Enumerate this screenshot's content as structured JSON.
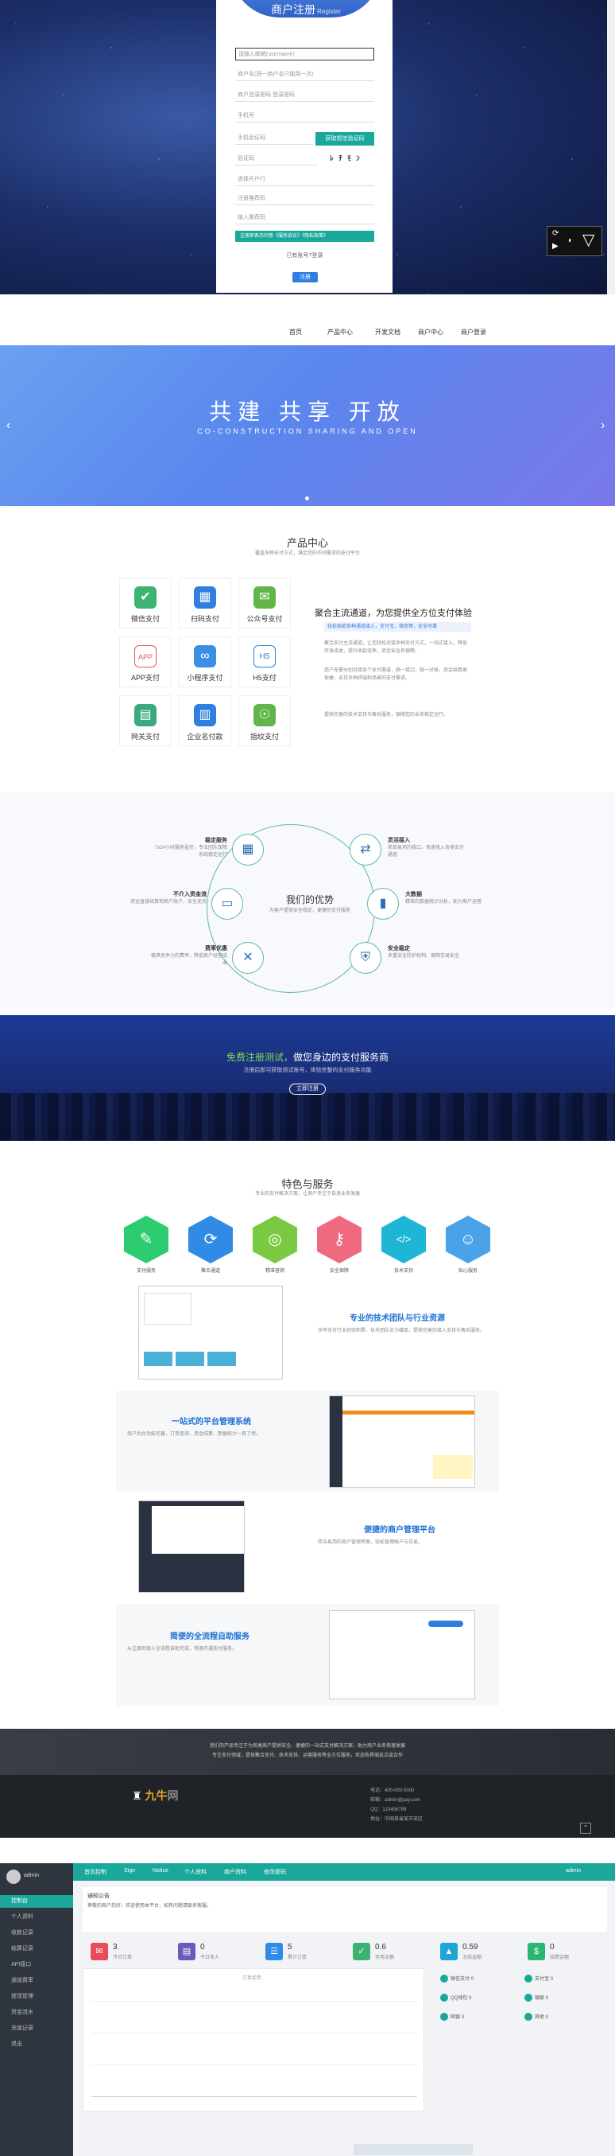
{
  "registration": {
    "title": "商户注册",
    "title_sub": "Register",
    "fields": [
      "请输入邮箱(username)",
      "商户名(同一商户名只能用一次)",
      "商户登录密码 登录密码",
      "手机号",
      "手机验证码",
      "验证码",
      "注册推荐码",
      "输入推荐码",
      "选择开户行"
    ],
    "sms_button": "获取短信验证码",
    "captcha_text": "ﾚ ﾁ ﾓ ﾝ",
    "agree_text": "注册即表示同意《服务协议》《隐私政策》",
    "to_login": "已有账号?登录",
    "submit": "注册",
    "video_controls": [
      "⟳",
      "▶",
      "◐",
      "▽"
    ]
  },
  "site": {
    "nav": [
      "首页",
      "产品中心",
      "开发文档",
      "商户中心",
      "商户登录"
    ],
    "hero": {
      "title": "共建  共享  开放",
      "subtitle": "CO-CONSTRUCTION  SHARING  AND  OPEN"
    },
    "products": {
      "title": "产品中心",
      "subtitle": "覆盖多种支付方式，满足您的不同需求的支付平台",
      "items": [
        {
          "label": "微信支付",
          "icon": "wechat-pay-icon",
          "color": "#3cb371",
          "glyph": "✔"
        },
        {
          "label": "扫码支付",
          "icon": "qrcode-pay-icon",
          "color": "#2f7fe0",
          "glyph": "▦"
        },
        {
          "label": "公众号支付",
          "icon": "official-account-icon",
          "color": "#62b54a",
          "glyph": "✉"
        },
        {
          "label": "APP支付",
          "icon": "app-pay-icon",
          "color": "#e35b5b",
          "glyph": "APP"
        },
        {
          "label": "小程序支付",
          "icon": "mini-program-icon",
          "color": "#3a8ee6",
          "glyph": "∞"
        },
        {
          "label": "H5支付",
          "icon": "h5-pay-icon",
          "color": "#2f7fe0",
          "glyph": "H5"
        },
        {
          "label": "网关支付",
          "icon": "gateway-pay-icon",
          "color": "#3aa97e",
          "glyph": "▤"
        },
        {
          "label": "企业名付款",
          "icon": "enterprise-pay-icon",
          "color": "#2f7fe0",
          "glyph": "▥"
        },
        {
          "label": "指纹支付",
          "icon": "fingerprint-pay-icon",
          "color": "#62b54a",
          "glyph": "☉"
        }
      ],
      "desc_title": "聚合主流通道，为您提供全方位支付体验",
      "desc_tag": "轻松收款各种通道接入，支付宝，微信等，安全可靠",
      "desc_paras": [
        "聚合支付主流通道，让您轻松对接多种支付方式，一站式接入，降低开发成本，提升收款效率，资金安全有保障。",
        "商户无需分别对接各个支付渠道，统一接口，统一对账，资金结算更快捷，支持多种终端和场景的支付需求。",
        "提供完善的技术支持与售后服务，保障您的业务稳定运行。"
      ]
    },
    "advantages": {
      "title": "我们的优势",
      "subtitle": "为客户提供安全稳定，便捷的支付服务",
      "items": [
        {
          "title": "稳定服务",
          "text": "7x24小时服务监控，专业团队保障系统稳定运行",
          "icon": "monitor-icon"
        },
        {
          "title": "灵活接入",
          "text": "简单易用的接口，快速接入各类支付通道",
          "icon": "plug-icon"
        },
        {
          "title": "不介入资金流",
          "text": "资金直接结算到商户账户，安全无忧",
          "icon": "wallet-icon"
        },
        {
          "title": "大数据",
          "text": "精准的数据统计分析，助力商户运营",
          "icon": "chart-icon"
        },
        {
          "title": "费率优惠",
          "text": "极具竞争力的费率，降低商户经营成本",
          "icon": "discount-icon"
        },
        {
          "title": "安全稳定",
          "text": "多重安全防护机制，保障交易安全",
          "icon": "shield-icon"
        }
      ]
    },
    "cta": {
      "title_green": "免费注册测试，",
      "title_white": "做您身边的支付服务商",
      "subtitle": "注册后即可获取测试账号，体验完整的支付服务功能",
      "button": "立即注册"
    },
    "features": {
      "title": "特色与服务",
      "subtitle": "专业的支付解决方案，让商户专注于自身业务发展",
      "hexes": [
        {
          "label": "支付服务",
          "color": "#2ecc71",
          "icon": "tag-icon",
          "glyph": "✎"
        },
        {
          "label": "聚合通道",
          "color": "#2f8be6",
          "icon": "network-icon",
          "glyph": "⟳"
        },
        {
          "label": "精准营销",
          "color": "#7ac943",
          "icon": "target-icon",
          "glyph": "◎"
        },
        {
          "label": "安全保障",
          "color": "#ef6a80",
          "icon": "lock-icon",
          "glyph": "⚷"
        },
        {
          "label": "技术支持",
          "color": "#1fb5d6",
          "icon": "code-icon",
          "glyph": "</>"
        },
        {
          "label": "贴心服务",
          "color": "#4aa3e8",
          "icon": "users-icon",
          "glyph": "☺"
        }
      ],
      "blocks": [
        {
          "title": "专业的技术团队与行业资源",
          "text": "多年支付行业经验积累，技术团队实力雄厚，提供完善的接入支持与售后服务。"
        },
        {
          "title": "一站式的平台管理系统",
          "text": "商户后台功能完善，订单查询、资金结算、数据统计一目了然。"
        },
        {
          "title": "便捷的商户管理平台",
          "text": "简洁易用的商户管理界面，轻松管理账户与交易。"
        },
        {
          "title": "简便的全流程自助服务",
          "text": "从注册到接入全流程自助完成，快速开通支付服务。"
        }
      ]
    },
    "footer": {
      "lines": [
        "我们的产品专注于为各类商户提供安全、便捷的一站式支付解决方案，助力商户业务快速发展",
        "专注支付领域，提供聚合支付、技术支持、运营服务等全方位服务，欢迎各界朋友洽谈合作"
      ],
      "logo": "九牛",
      "logo_suffix": "网",
      "contacts": [
        "电话：400-000-0000",
        "邮箱：admin@pay.com",
        "QQ：123456789",
        "地址：中国某省某市某区"
      ]
    }
  },
  "admin": {
    "top_tabs": [
      "首页控制",
      "Sign",
      "Notice",
      "个人资料",
      "商户资料",
      "修改密码"
    ],
    "user": "admin",
    "sidebar": [
      "控制台",
      "个人资料",
      "收款记录",
      "结算记录",
      "API接口",
      "通道费率",
      "提现管理",
      "资金流水",
      "充值记录",
      "退出"
    ],
    "notice_title": "通知公告",
    "notice_text": "尊敬的商户您好，欢迎使用本平台，如有问题请联系客服。",
    "stats": [
      {
        "label": "今日订单",
        "value": "3",
        "color": "#e84b5a",
        "glyph": "✉"
      },
      {
        "label": "今日收入",
        "value": "0",
        "color": "#6b5bb8",
        "glyph": "▤"
      },
      {
        "label": "累计订单",
        "value": "5",
        "color": "#2f8be6",
        "glyph": "☰"
      },
      {
        "label": "可用余额",
        "value": "0.6",
        "color": "#3cb371",
        "glyph": "✓"
      },
      {
        "label": "冻结金额",
        "value": "0.59",
        "color": "#1fa5d8",
        "glyph": "▲"
      },
      {
        "label": "结算金额",
        "value": "0",
        "color": "#2bb673",
        "glyph": "$"
      }
    ],
    "chart_label": "订单走势",
    "side_stats": [
      "微信支付",
      "支付宝",
      "QQ钱包",
      "银联",
      "网银",
      "其他"
    ],
    "side_stat_values": [
      "0",
      "0",
      "0",
      "0",
      "0",
      "0"
    ]
  }
}
